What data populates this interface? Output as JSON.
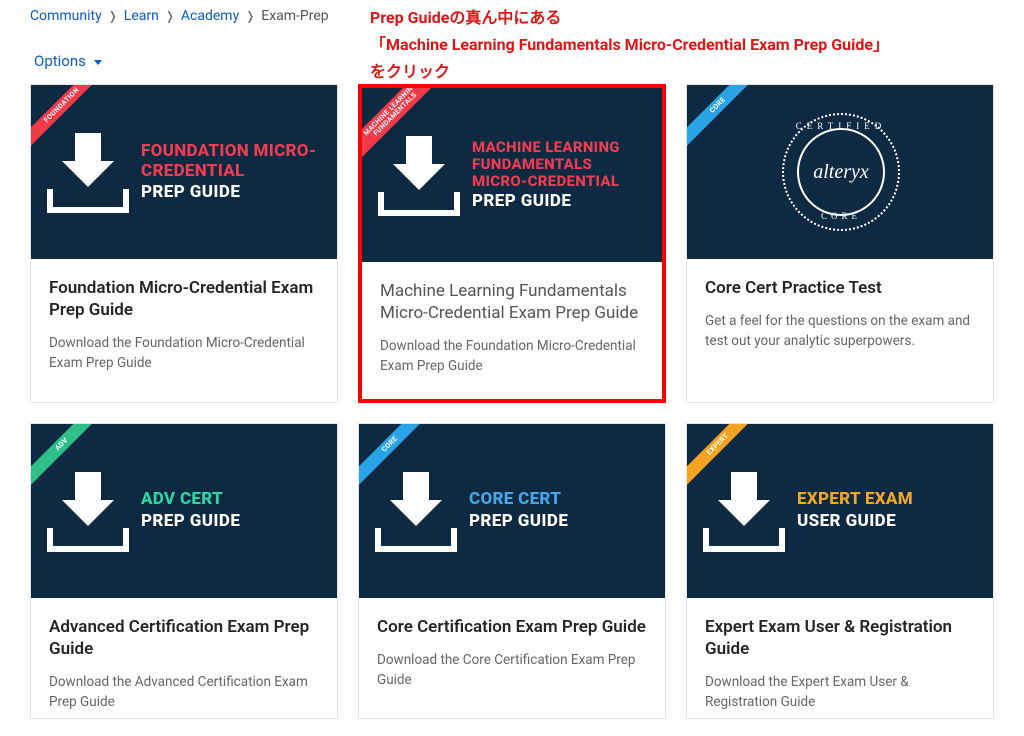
{
  "breadcrumb": {
    "items": [
      "Community",
      "Learn",
      "Academy"
    ],
    "current": "Exam-Prep"
  },
  "annotation": {
    "line1": "Prep Guideの真ん中にある",
    "line2": "「Machine Learning Fundamentals Micro-Credential Exam Prep Guide」",
    "line3": "をクリック"
  },
  "options_label": "Options",
  "cards": [
    {
      "ribbon": "FOUNDATION",
      "ribbon_color": "red",
      "thumb_line1": "FOUNDATION MICRO-CREDENTIAL",
      "thumb_line2": "PREP GUIDE",
      "accent": "red",
      "title": "Foundation Micro-Credential Exam Prep Guide",
      "desc": "Download the Foundation Micro-Credential Exam Prep Guide",
      "highlight": false,
      "title_light": false
    },
    {
      "ribbon": "MACHINE LEARNING FUNDAMENTALS",
      "ribbon_color": "red",
      "thumb_line1": "MACHINE LEARNING FUNDAMENTALS MICRO-CREDENTIAL",
      "thumb_line2": "PREP GUIDE",
      "accent": "red",
      "title": "Machine Learning Fundamentals Micro-Credential Exam Prep Guide",
      "desc": "Download the Foundation Micro-Credential Exam Prep Guide",
      "highlight": true,
      "title_light": true
    },
    {
      "ribbon": "CORE",
      "ribbon_color": "blue",
      "seal_top": "CERTIFIED",
      "seal_mid": "alteryx",
      "seal_bot": "CORE",
      "title": "Core Cert Practice Test",
      "desc": "Get a feel for the questions on the exam and test out your analytic superpowers.",
      "highlight": false,
      "title_light": false,
      "seal": true
    },
    {
      "ribbon": "ADV",
      "ribbon_color": "green",
      "thumb_line1": "ADV CERT",
      "thumb_line2": "PREP GUIDE",
      "accent": "teal",
      "title": "Advanced Certification Exam Prep Guide",
      "desc": "Download the Advanced Certification Exam Prep Guide",
      "highlight": false,
      "title_light": false
    },
    {
      "ribbon": "CORE",
      "ribbon_color": "blue",
      "thumb_line1": "CORE CERT",
      "thumb_line2": "PREP GUIDE",
      "accent": "blue",
      "title": "Core Certification Exam Prep Guide",
      "desc": "Download the Core Certification Exam Prep Guide",
      "highlight": false,
      "title_light": false
    },
    {
      "ribbon": "EXPERT",
      "ribbon_color": "orange",
      "thumb_line1": "EXPERT EXAM",
      "thumb_line2": "USER GUIDE",
      "accent": "orange",
      "title": "Expert Exam User & Registration Guide",
      "desc": "Download the Expert Exam User & Registration Guide",
      "highlight": false,
      "title_light": false
    }
  ]
}
